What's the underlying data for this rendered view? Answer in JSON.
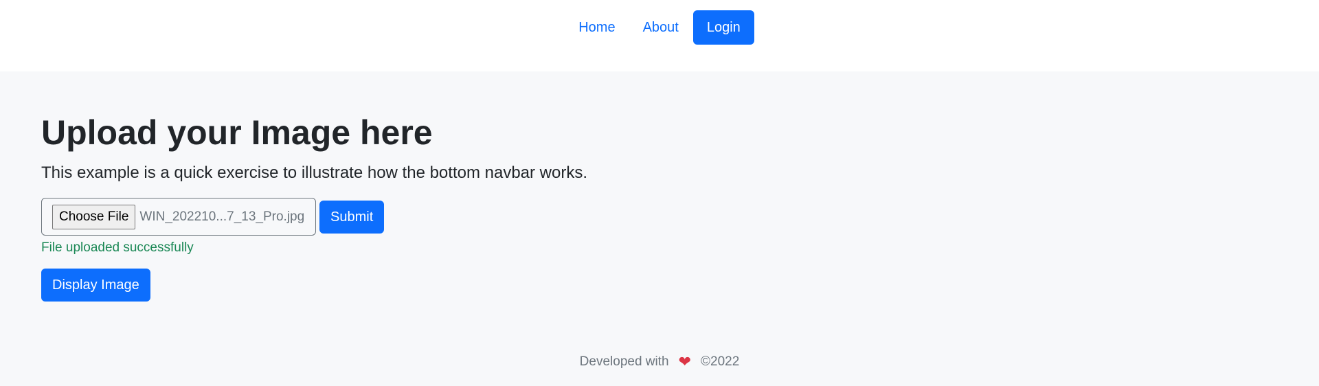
{
  "nav": {
    "items": [
      {
        "label": "Home"
      },
      {
        "label": "About"
      },
      {
        "label": "Login"
      }
    ]
  },
  "hero": {
    "title": "Upload your Image here",
    "lead": "This example is a quick exercise to illustrate how the bottom navbar works."
  },
  "upload": {
    "choose_label": "Choose File",
    "file_name": "WIN_202210...7_13_Pro.jpg",
    "submit_label": "Submit",
    "status": "File uploaded successfully",
    "display_label": "Display Image"
  },
  "footer": {
    "text_prefix": "Developed with",
    "heart_icon": "heart-icon",
    "copyright": "©2022"
  },
  "colors": {
    "primary": "#0d6efd",
    "success": "#198754",
    "heart": "#dc3545"
  }
}
